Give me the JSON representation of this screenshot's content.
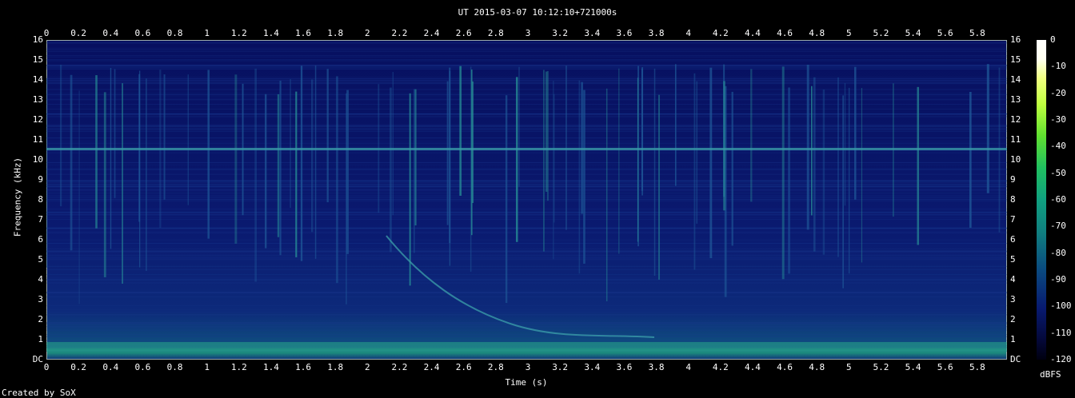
{
  "chart_data": {
    "type": "heatmap",
    "title": "UT 2015-03-07 10:12:10+721000s",
    "xlabel": "Time (s)",
    "ylabel": "Frequency (kHz)",
    "x_ticks": [
      "0",
      "0.2",
      "0.4",
      "0.6",
      "0.8",
      "1",
      "1.2",
      "1.4",
      "1.6",
      "1.8",
      "2",
      "2.2",
      "2.4",
      "2.6",
      "2.8",
      "3",
      "3.2",
      "3.4",
      "3.6",
      "3.8",
      "4",
      "4.2",
      "4.4",
      "4.6",
      "4.8",
      "5",
      "5.2",
      "5.4",
      "5.6",
      "5.8"
    ],
    "y_ticks": [
      "DC",
      "1",
      "2",
      "3",
      "4",
      "5",
      "6",
      "7",
      "8",
      "9",
      "10",
      "11",
      "12",
      "13",
      "14",
      "15",
      "16"
    ],
    "xlim": [
      0,
      5.98
    ],
    "ylim": [
      0,
      16
    ],
    "colorbar": {
      "label": "dBFS",
      "ticks": [
        "0",
        "-10",
        "-20",
        "-30",
        "-40",
        "-50",
        "-60",
        "-70",
        "-80",
        "-90",
        "-100",
        "-110",
        "-120"
      ]
    },
    "credit": "Created by SoX"
  }
}
